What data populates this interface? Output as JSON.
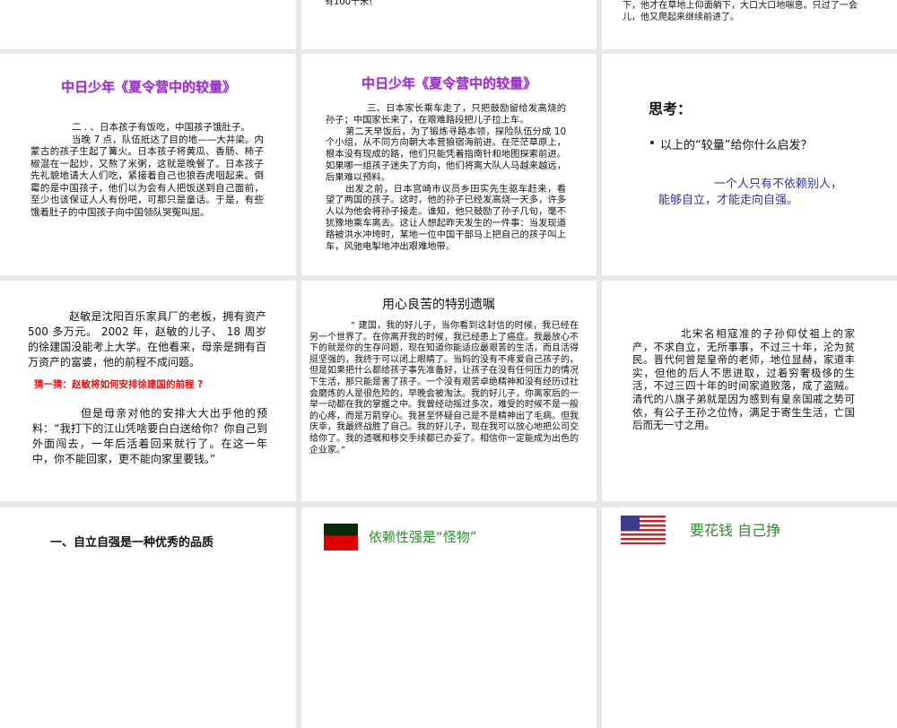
{
  "slides": [
    {
      "id": "top-left",
      "text": ""
    },
    {
      "id": "top-middle",
      "text": "有100千米!"
    },
    {
      "id": "top-right",
      "text": "长交待？我能挺得住，我一定要走到底！”在医生的劝说下，他才在草地上仰面躺下，大口大口地喘息。只过了一会儿，他又爬起来继续前进了。"
    },
    {
      "id": "slide-2",
      "title": "中日少年《夏令营中的较量》",
      "p1": "二 . 、日本孩子有饭吃，中国孩子饿肚子。",
      "p2": "当晚 7 点，队伍抵达了目的地——大井梁。内蒙古的孩子生起了篝火。日本孩子将黄瓜、香肠、柿子椒混在一起炒，又熬了米粥，这就是晚餐了。日本孩子先礼貌地请大人们吃，紧接着自己也狼吞虎咽起来。倒霉的是中国孩子，他们以为会有人把饭送到自己面前，至少也该保证人人有份吧，可那只是童话。于是，有些饿着肚子的中国孩子向中国领队哭冤叫屈。"
    },
    {
      "id": "slide-3",
      "title": "中日少年《夏令营中的较量》",
      "p1": "三、日本家长乘车走了，只把鼓励留给发高烧的孙子；中国家长来了，在艰难路段把儿子拉上车。",
      "p2": "第二天早饭后，为了锻炼寻路本领，探险队伍分成 10 个小组，从不同方向朝大本营狼宿海前进。在茫茫草原上，根本没有现成的路，他们只能凭着指南针和地图探索前进。如果哪一组孩子迷失了方向，他们将离大队人马越来越远，后果难以预料。",
      "p3": "出发之前，日本宫崎市议员乡田实先生驱车赶来，看望了两国的孩子。这时，他的孙子已经发高烧一天多，许多人以为他会将孙子接走。谁知，他只鼓励了孙子几句，毫不犹豫地乘车离去。这让人想起昨天发生的一件事：当发现道路被洪水冲垮时，某地一位中国干部马上把自己的孩子叫上车，风驰电掣地冲出艰难地带。"
    },
    {
      "id": "slide-4",
      "heading": "思考：",
      "bullet": "以上的“较量”给你什么启发？",
      "answer1": "一个人只有不依赖别人，",
      "answer2": "能够自立，才能走向自强。"
    },
    {
      "id": "slide-5",
      "p1": "赵敏是沈阳百乐家具厂的老板，拥有资产 500 多万元。 2002 年，赵敏的儿子、 18 周岁的徐建国没能考上大学。在他看来，母亲是拥有百万资产的富婆，他的前程不成问题。",
      "question": "猜一猜：赵敏将如何安排徐建国的前程 ?",
      "p2": "但是母亲对他的安排大大出乎他的预料：“我打下的江山凭啥要白白送给你？你自己到外面闯去，一年后活着回来就行了。在这一年中，你不能回家，更不能向家里要钱。”"
    },
    {
      "id": "slide-6",
      "title": "用心良苦的特别遗嘱",
      "p1": "“ 建国，我的好儿子，当你看到这封信的时候，我已经在另一个世界了。在你离开我的时候，我已经患上了癌症。我最放心不下的就是你的生存问题，现在知道你能适应最艰苦的生活，而且活得挺坚强的，我终于可以闭上眼睛了。当妈的没有不疼爱自己孩子的，但是如果把什么都给孩子事先准备好，让孩子在没有任何压力的情况下生活，那只能是害了孩子。一个没有艰苦卓绝精神和没有经历过社会磨炼的人是很危险的，早晚会被淘汰。我的好儿子，你离家后的一举一动都在我的掌握之中。我曾经动摇过多次，难受的时候不是一般的心疼，而是万箭穿心。我甚至怀疑自己是不是精神出了毛病。但我庆幸，我最终战胜了自己。我的好儿子，现在我可以放心地把公司交给你了。我的遗嘱和移交手续都已办妥了。相信你一定能成为出色的企业家。”"
    },
    {
      "id": "slide-7",
      "p1": "北宋名相寇准的子孙仰仗祖上的家产，不求自立，无所事事，不过三十年，沦为贫民。晋代何曾是皇帝的老师，地位显赫，家道丰实，但他的后人不思进取，过着穷奢极侈的生活，不过三四十年的时间家道败落，成了盗贼。清代的八旗子弟就是因为感到有皇亲国戚之势可依，有公子王孙之位恃，满足于寄生生活，亡国后而无一寸之用。"
    },
    {
      "id": "slide-8",
      "title": "一、自立自强是一种优秀的品质"
    },
    {
      "id": "slide-9",
      "title": "依赖性强是“怪物”"
    },
    {
      "id": "slide-10",
      "title": "要花钱 自己挣"
    }
  ],
  "colors": {
    "background": "#e8e8e8",
    "title_purple": "#9b2fc9",
    "answer_blue": "#333399",
    "question_red": "#e01010",
    "green_title": "#2e8b2e"
  }
}
